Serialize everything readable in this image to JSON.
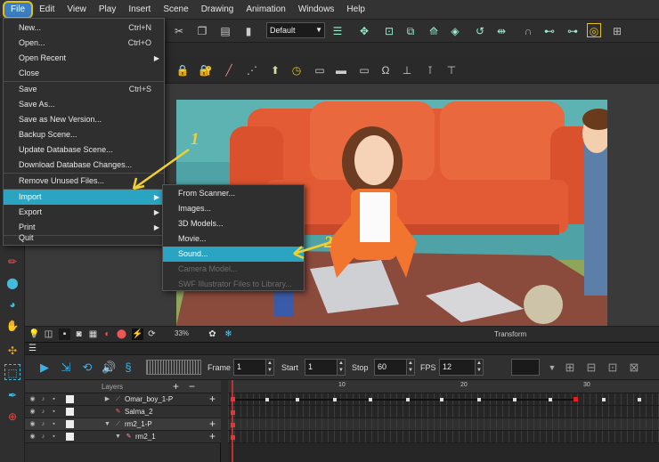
{
  "menubar": {
    "items": [
      "File",
      "Edit",
      "View",
      "Play",
      "Insert",
      "Scene",
      "Drawing",
      "Animation",
      "Windows",
      "Help"
    ]
  },
  "toolbar": {
    "preset": "Default"
  },
  "file_menu": {
    "items": [
      {
        "label": "New...",
        "shortcut": "Ctrl+N"
      },
      {
        "label": "Open...",
        "shortcut": "Ctrl+O"
      },
      {
        "label": "Open Recent",
        "submenu": true
      },
      {
        "label": "Close"
      },
      {
        "label": "Save",
        "shortcut": "Ctrl+S"
      },
      {
        "label": "Save As..."
      },
      {
        "label": "Save as New Version..."
      },
      {
        "label": "Backup Scene..."
      },
      {
        "label": "Update Database Scene..."
      },
      {
        "label": "Download Database Changes..."
      },
      {
        "label": "Remove Unused Files..."
      },
      {
        "label": "Import",
        "submenu": true,
        "highlighted": true
      },
      {
        "label": "Export",
        "submenu": true
      },
      {
        "label": "Print",
        "submenu": true
      },
      {
        "label": "Quit"
      }
    ]
  },
  "import_submenu": {
    "items": [
      {
        "label": "From Scanner..."
      },
      {
        "label": "Images..."
      },
      {
        "label": "3D Models..."
      },
      {
        "label": "Movie..."
      },
      {
        "label": "Sound...",
        "highlighted": true
      },
      {
        "label": "Camera Model...",
        "disabled": true
      },
      {
        "label": "SWF Illustrator Files to Library...",
        "disabled": true
      }
    ]
  },
  "annotations": {
    "step1": "1",
    "step2": "2"
  },
  "view_bar": {
    "zoom": "33%",
    "mode": "Transform"
  },
  "timeline": {
    "frame_label": "Frame",
    "frame_value": "1",
    "start_label": "Start",
    "start_value": "1",
    "stop_label": "Stop",
    "stop_value": "60",
    "fps_label": "FPS",
    "fps_value": "12",
    "layers_header": "Layers",
    "ruler_ticks": [
      "10",
      "20",
      "30"
    ],
    "layers": [
      {
        "name": "Omar_boy_1-P"
      },
      {
        "name": "Salma_2"
      },
      {
        "name": "rm2_1-P"
      },
      {
        "name": "rm2_1"
      }
    ]
  },
  "colors": {
    "highlight": "#2aa4c0",
    "annotation": "#f0d030",
    "menu_bg": "#2f2f2f"
  }
}
